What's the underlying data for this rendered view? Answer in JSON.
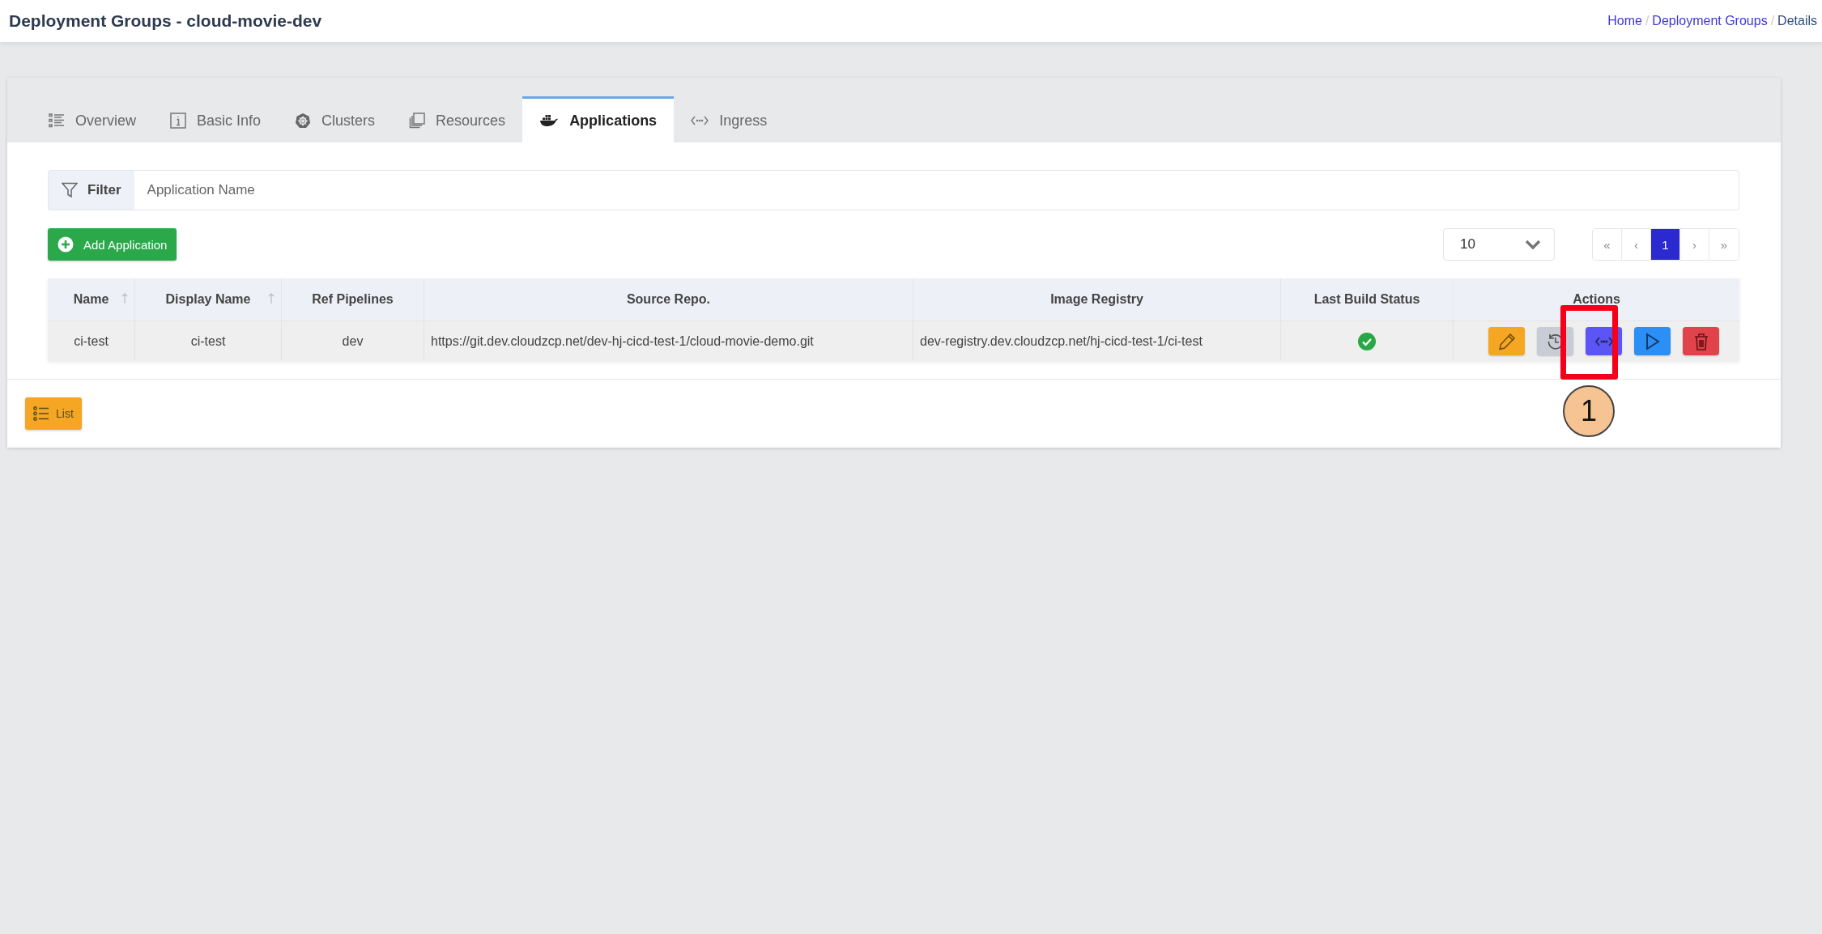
{
  "header": {
    "title": "Deployment Groups - cloud-movie-dev",
    "separator": "/",
    "breadcrumb": [
      {
        "label": "Home",
        "link": true
      },
      {
        "label": "Deployment Groups",
        "link": true
      },
      {
        "label": "Details",
        "link": false
      }
    ]
  },
  "tabs": [
    {
      "label": "Overview",
      "kind": "list",
      "selected": false
    },
    {
      "label": "Basic Info",
      "kind": "info",
      "selected": false
    },
    {
      "label": "Clusters",
      "kind": "helm",
      "selected": false
    },
    {
      "label": "Resources",
      "kind": "copies",
      "selected": false
    },
    {
      "label": "Applications",
      "kind": "whale",
      "selected": true
    },
    {
      "label": "Ingress",
      "kind": "code",
      "selected": false
    }
  ],
  "filter": {
    "label": "Filter",
    "placeholder": "Application Name"
  },
  "add_button": "Add Application",
  "page_size": "10",
  "pagination": [
    {
      "label": "«",
      "selected": false
    },
    {
      "label": "‹",
      "selected": false
    },
    {
      "label": "1",
      "selected": true
    },
    {
      "label": "›",
      "selected": false
    },
    {
      "label": "»",
      "selected": false
    }
  ],
  "table": {
    "columns": [
      {
        "label": "Name",
        "sortable": true
      },
      {
        "label": "Display Name",
        "sortable": true
      },
      {
        "label": "Ref Pipelines",
        "sortable": false
      },
      {
        "label": "Source Repo.",
        "sortable": false
      },
      {
        "label": "Image Registry",
        "sortable": false
      },
      {
        "label": "Last Build Status",
        "sortable": false
      },
      {
        "label": "Actions",
        "sortable": false
      }
    ],
    "rows": [
      {
        "name": "ci-test",
        "display_name": "ci-test",
        "ref_pipelines": "dev",
        "source_repo": "https://git.dev.cloudzcp.net/dev-hj-cicd-test-1/cloud-movie-demo.git",
        "image_registry": "dev-registry.dev.cloudzcp.net/hj-cicd-test-1/ci-test",
        "build_ok": true,
        "actions": [
          {
            "kind": "edit"
          },
          {
            "kind": "history"
          },
          {
            "kind": "code"
          },
          {
            "kind": "run"
          },
          {
            "kind": "delete"
          }
        ]
      }
    ]
  },
  "list_button": "List",
  "annotation": {
    "label": "1"
  }
}
